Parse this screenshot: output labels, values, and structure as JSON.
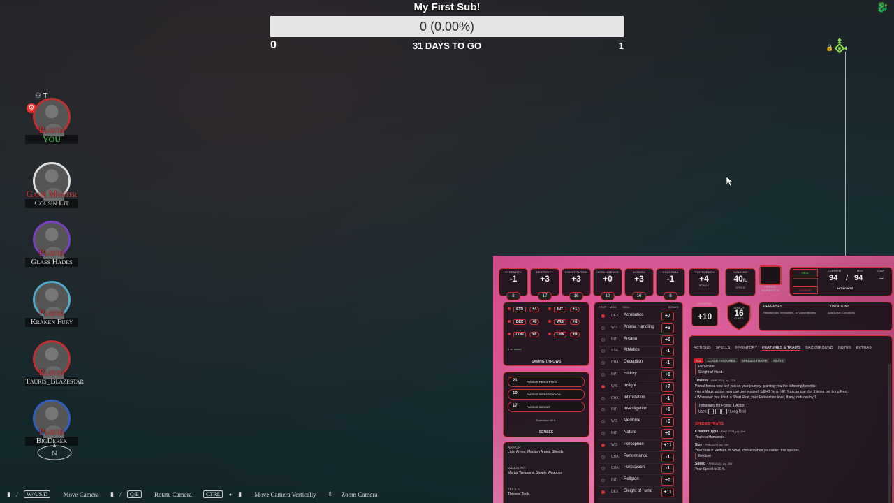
{
  "goal": {
    "title": "My First Sub!",
    "progress_text": "0 (0.00%)",
    "progress_fraction": 0,
    "min": "0",
    "max": "1",
    "days_left": "31 DAYS TO GO"
  },
  "players": [
    {
      "role": "Player",
      "name": "YOU",
      "ring": "#c0302f",
      "tag": "T",
      "has_gear": true
    },
    {
      "role": "Game Master",
      "name": "Cousin Lit",
      "ring": "#dcdcdc"
    },
    {
      "role": "Player",
      "name": "Glass Hades",
      "ring": "#7a3fc2"
    },
    {
      "role": "Player",
      "name": "Kraken Fury",
      "ring": "#4fa8c8"
    },
    {
      "role": "Player",
      "name": "Tauris_Blazestar",
      "ring": "#c0302f"
    },
    {
      "role": "Player",
      "name": "BigDerek",
      "ring": "#2f5fc0"
    }
  ],
  "hints": {
    "move_keys": "W/A/S/D",
    "move_label": "Move Camera",
    "rotate_keys": "Q/E",
    "rotate_label": "Rotate Camera",
    "vertical_key": "CTRL",
    "vertical_label": "Move Camera Vertically",
    "zoom_label": "Zoom Camera"
  },
  "sheet": {
    "abilities": [
      {
        "label": "STRENGTH",
        "mod": "-1",
        "score": "8"
      },
      {
        "label": "DEXTERITY",
        "mod": "+3",
        "score": "17"
      },
      {
        "label": "CONSTITUTION",
        "mod": "+3",
        "score": "16"
      },
      {
        "label": "INTELLIGENCE",
        "mod": "+0",
        "score": "10"
      },
      {
        "label": "WISDOM",
        "mod": "+3",
        "score": "16"
      },
      {
        "label": "CHARISMA",
        "mod": "-1",
        "score": "8"
      }
    ],
    "proficiency": {
      "label": "PROFICIENCY",
      "value": "+4",
      "sub": "BONUS"
    },
    "speed": {
      "label": "WALKING",
      "value": "40",
      "unit": "ft.",
      "sub": "SPEED"
    },
    "heroic": "HEROIC INSPIRATION",
    "hp": {
      "heal": "HEAL",
      "damage": "DAMAGE",
      "current_label": "CURRENT",
      "max_label": "MAX",
      "temp_label": "TEMP",
      "current": "94",
      "sep": "/",
      "max": "94",
      "temp": "--",
      "title": "HIT POINTS"
    },
    "saves": [
      {
        "ab": "STR",
        "val": "+4"
      },
      {
        "ab": "INT",
        "val": "+1"
      },
      {
        "ab": "DEX",
        "val": "+8"
      },
      {
        "ab": "WIS",
        "val": "+8"
      },
      {
        "ab": "CON",
        "val": "+8"
      },
      {
        "ab": "CHA",
        "val": "+0"
      }
    ],
    "saving_throws_label": "SAVING THROWS",
    "saves_note": "1 on saves",
    "passives": [
      {
        "val": "21",
        "label": "PASSIVE PERCEPTION"
      },
      {
        "val": "10",
        "label": "PASSIVE INVESTIGATION"
      },
      {
        "val": "17",
        "label": "PASSIVE INSIGHT"
      }
    ],
    "darkvision": "Darkvision 60 ft.",
    "senses_label": "SENSES",
    "initiative": {
      "label": "INITIATIVE",
      "value": "+10"
    },
    "armor": {
      "label": "ARMOR",
      "value": "16",
      "sub": "CLASS"
    },
    "defenses": {
      "title": "DEFENSES",
      "text": "Resistances, Immunities, or Vulnerabilities"
    },
    "conditions": {
      "title": "CONDITIONS",
      "text": "Add Active Conditions"
    },
    "skill_headers": {
      "prof": "PROF",
      "mod": "MOD",
      "skill": "SKILL",
      "bonus": "BONUS"
    },
    "skills": [
      {
        "ab": "DEX",
        "name": "Acrobatics",
        "bonus": "+7",
        "prof": true
      },
      {
        "ab": "WIS",
        "name": "Animal Handling",
        "bonus": "+3",
        "prof": false
      },
      {
        "ab": "INT",
        "name": "Arcana",
        "bonus": "+0",
        "prof": false
      },
      {
        "ab": "STR",
        "name": "Athletics",
        "bonus": "-1",
        "prof": false
      },
      {
        "ab": "CHA",
        "name": "Deception",
        "bonus": "-1",
        "prof": false
      },
      {
        "ab": "INT",
        "name": "History",
        "bonus": "+0",
        "prof": false
      },
      {
        "ab": "WIS",
        "name": "Insight",
        "bonus": "+7",
        "prof": true
      },
      {
        "ab": "CHA",
        "name": "Intimidation",
        "bonus": "-1",
        "prof": false
      },
      {
        "ab": "INT",
        "name": "Investigation",
        "bonus": "+0",
        "prof": false
      },
      {
        "ab": "WIS",
        "name": "Medicine",
        "bonus": "+3",
        "prof": false
      },
      {
        "ab": "INT",
        "name": "Nature",
        "bonus": "+0",
        "prof": false
      },
      {
        "ab": "WIS",
        "name": "Perception",
        "bonus": "+11",
        "prof": true
      },
      {
        "ab": "CHA",
        "name": "Performance",
        "bonus": "-1",
        "prof": false
      },
      {
        "ab": "CHA",
        "name": "Persuasion",
        "bonus": "-1",
        "prof": false
      },
      {
        "ab": "INT",
        "name": "Religion",
        "bonus": "+0",
        "prof": false
      },
      {
        "ab": "DEX",
        "name": "Sleight of Hand",
        "bonus": "+11",
        "prof": true
      }
    ],
    "proficiencies": [
      {
        "title": "ARMOR",
        "text": "Light Armor, Medium Armor, Shields"
      },
      {
        "title": "WEAPONS",
        "text": "Martial Weapons, Simple Weapons"
      },
      {
        "title": "TOOLS",
        "text": "Thieves' Tools"
      }
    ],
    "tabs": [
      "ACTIONS",
      "SPELLS",
      "INVENTORY",
      "FEATURES & TRAITS",
      "BACKGROUND",
      "NOTES",
      "EXTRAS"
    ],
    "filters": [
      "ALL",
      "CLASS FEATURES",
      "SPECIES TRAITS",
      "FEATS"
    ],
    "features": {
      "list1": "Perception",
      "list2": "Sleight of Hand",
      "tireless_title": "Tireless",
      "tireless_src": "PHB-2024, pg. 121",
      "tireless_text": "Primal forces now fuel you on your journey, granting you the following benefits:",
      "tireless_b1": "As a Magic action, you can give yourself 1d8+3 Temp HP. You can use this 3 times per Long Rest.",
      "tireless_b2": "Whenever you finish a Short Rest, your Exhaustion level, if any, reduces by 1.",
      "temp_hp": "Temporary Hit Points: 1 Action",
      "uses_label": "Uses:",
      "uses_rest": "/ Long Rest",
      "species_header": "SPECIES TRAITS",
      "creature_title": "Creature Type",
      "creature_src": "PHB-2024, pg. 194",
      "creature_text": "You're a Humanoid.",
      "size_title": "Size",
      "size_src": "PHB-2024, pg. 194",
      "size_text": "Your Size is Medium or Small, chosen when you select this species.",
      "size_value": "Medium",
      "speed_title": "Speed",
      "speed_src": "PHB-2024, pg. 194",
      "speed_text": "Your Speed is 30 ft."
    }
  }
}
